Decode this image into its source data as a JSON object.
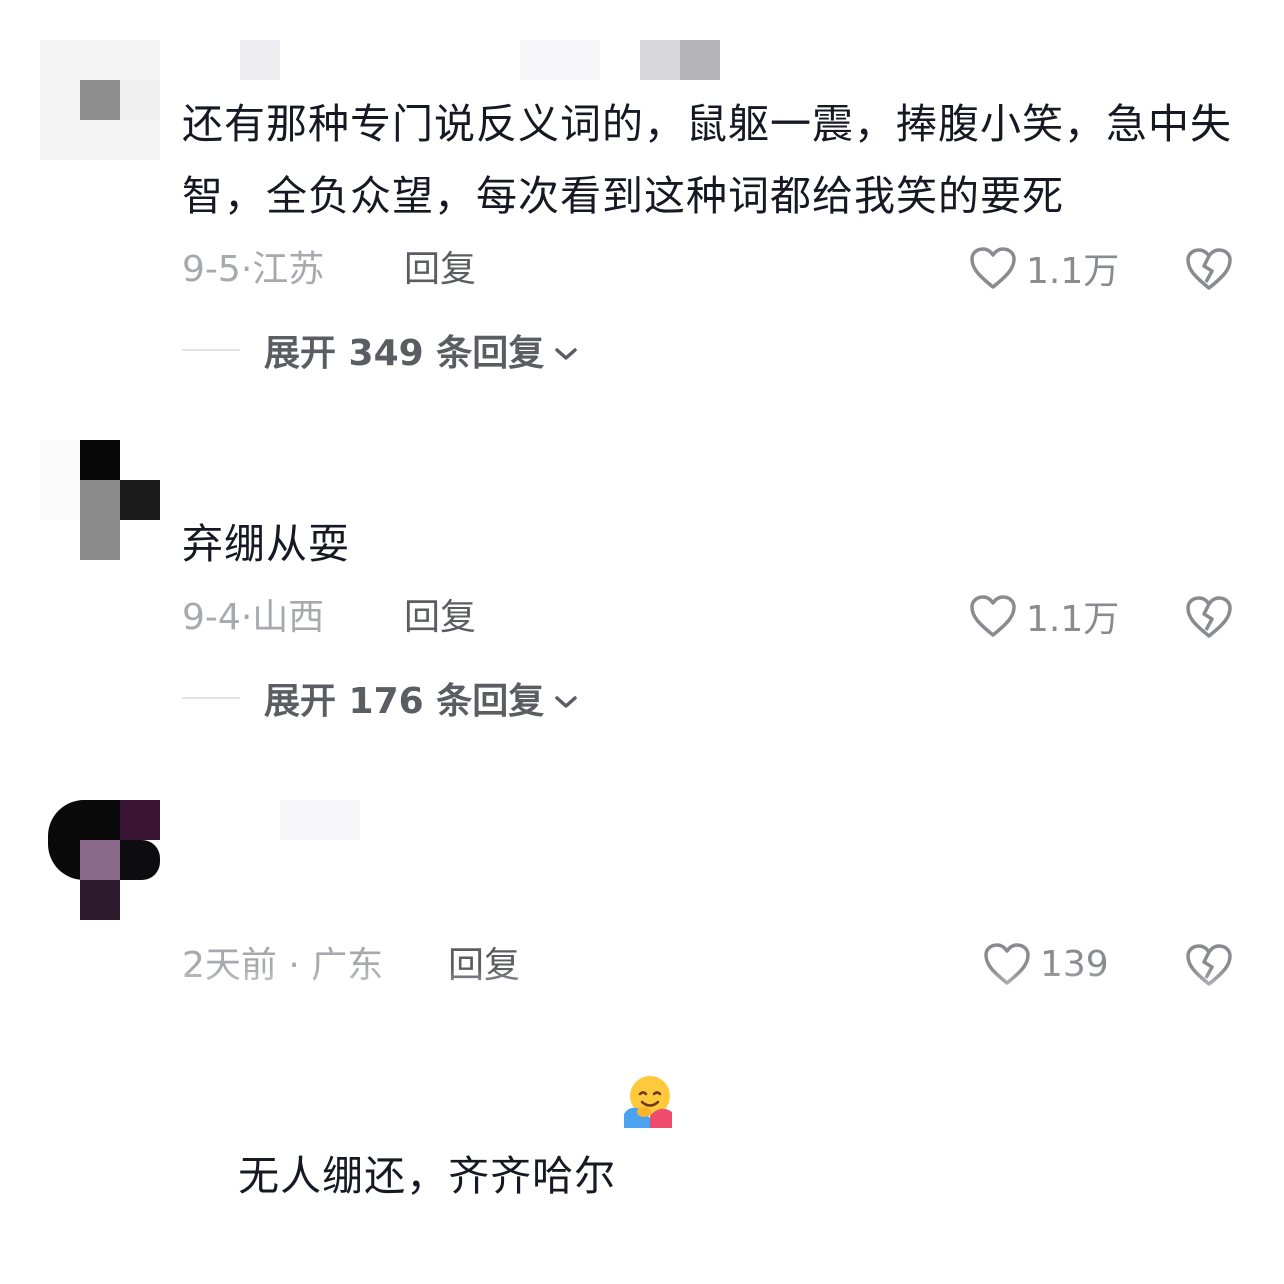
{
  "comments": [
    {
      "text": "还有那种专门说反义词的，鼠躯一震，捧腹小笑，急中失智，全负众望，每次看到这种词都给我笑的要死",
      "date": "9-5",
      "location": "江苏",
      "reply_label": "回复",
      "likes": "1.1万",
      "expand_label": "展开 349 条回复"
    },
    {
      "text": "弃绷从耍",
      "date": "9-4",
      "location": "山西",
      "reply_label": "回复",
      "likes": "1.1万",
      "expand_label": "展开 176 条回复"
    },
    {
      "text": "无人绷还，齐齐哈尔",
      "date": "2天前",
      "location": "广东",
      "reply_label": "回复",
      "likes": "139"
    }
  ],
  "icons": {
    "like": "heart-outline-icon",
    "dislike": "broken-heart-icon",
    "expand": "chevron-down-icon",
    "emoji": "hugging-face-emoji"
  },
  "colors": {
    "text": "#161823",
    "meta": "#a8a9ae",
    "reply": "#5c5d63",
    "icon": "#8a8b91"
  }
}
